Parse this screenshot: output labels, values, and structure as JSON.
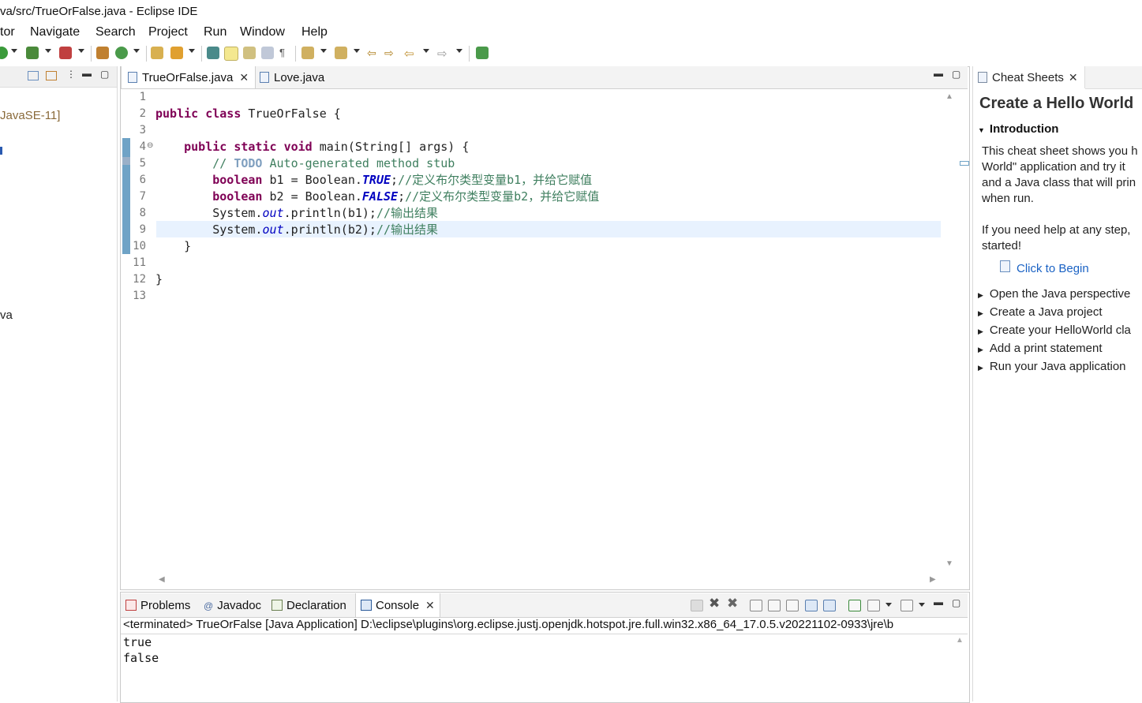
{
  "window": {
    "title": "va/src/TrueOrFalse.java - Eclipse IDE"
  },
  "menu": [
    "tor",
    "Navigate",
    "Search",
    "Project",
    "Run",
    "Window",
    "Help"
  ],
  "left_panel": {
    "items": [
      "JavaSE-11]",
      "va"
    ]
  },
  "editor": {
    "tabs": [
      {
        "label": "TrueOrFalse.java",
        "active": true
      },
      {
        "label": "Love.java",
        "active": false
      }
    ],
    "lines": [
      "",
      "public class TrueOrFalse {",
      "",
      "    public static void main(String[] args) {",
      "        // TODO Auto-generated method stub",
      "        boolean b1 = Boolean.TRUE;//定义布尔类型变量b1，并给它赋值",
      "        boolean b2 = Boolean.FALSE;//定义布尔类型变量b2，并给它赋值",
      "        System.out.println(b1);//输出结果",
      "        System.out.println(b2);//输出结果",
      "    }",
      "",
      "}",
      ""
    ],
    "line_numbers": [
      "1",
      "2",
      "3",
      "4",
      "5",
      "6",
      "7",
      "8",
      "9",
      "10",
      "11",
      "12",
      "13"
    ],
    "current_line": 9
  },
  "cheat_sheets": {
    "tab_label": "Cheat Sheets",
    "title": "Create a Hello World",
    "section": "Introduction",
    "intro_lines": [
      "This cheat sheet shows you h",
      "World\" application and try it",
      "and a Java class that will prin",
      "when run."
    ],
    "help_lines": [
      "If you need help at any step,",
      "started!"
    ],
    "begin_link": "Click to Begin",
    "steps": [
      "Open the Java perspective",
      "Create a Java project",
      "Create your HelloWorld cla",
      "Add a print statement",
      "Run your Java application"
    ]
  },
  "bottom_panel": {
    "tabs": [
      {
        "label": "Problems"
      },
      {
        "label": "Javadoc"
      },
      {
        "label": "Declaration"
      },
      {
        "label": "Console",
        "active": true
      }
    ],
    "console_header": "<terminated> TrueOrFalse [Java Application] D:\\eclipse\\plugins\\org.eclipse.justj.openjdk.hotspot.jre.full.win32.x86_64_17.0.5.v20221102-0933\\jre\\b",
    "output": [
      "true",
      "false"
    ]
  }
}
